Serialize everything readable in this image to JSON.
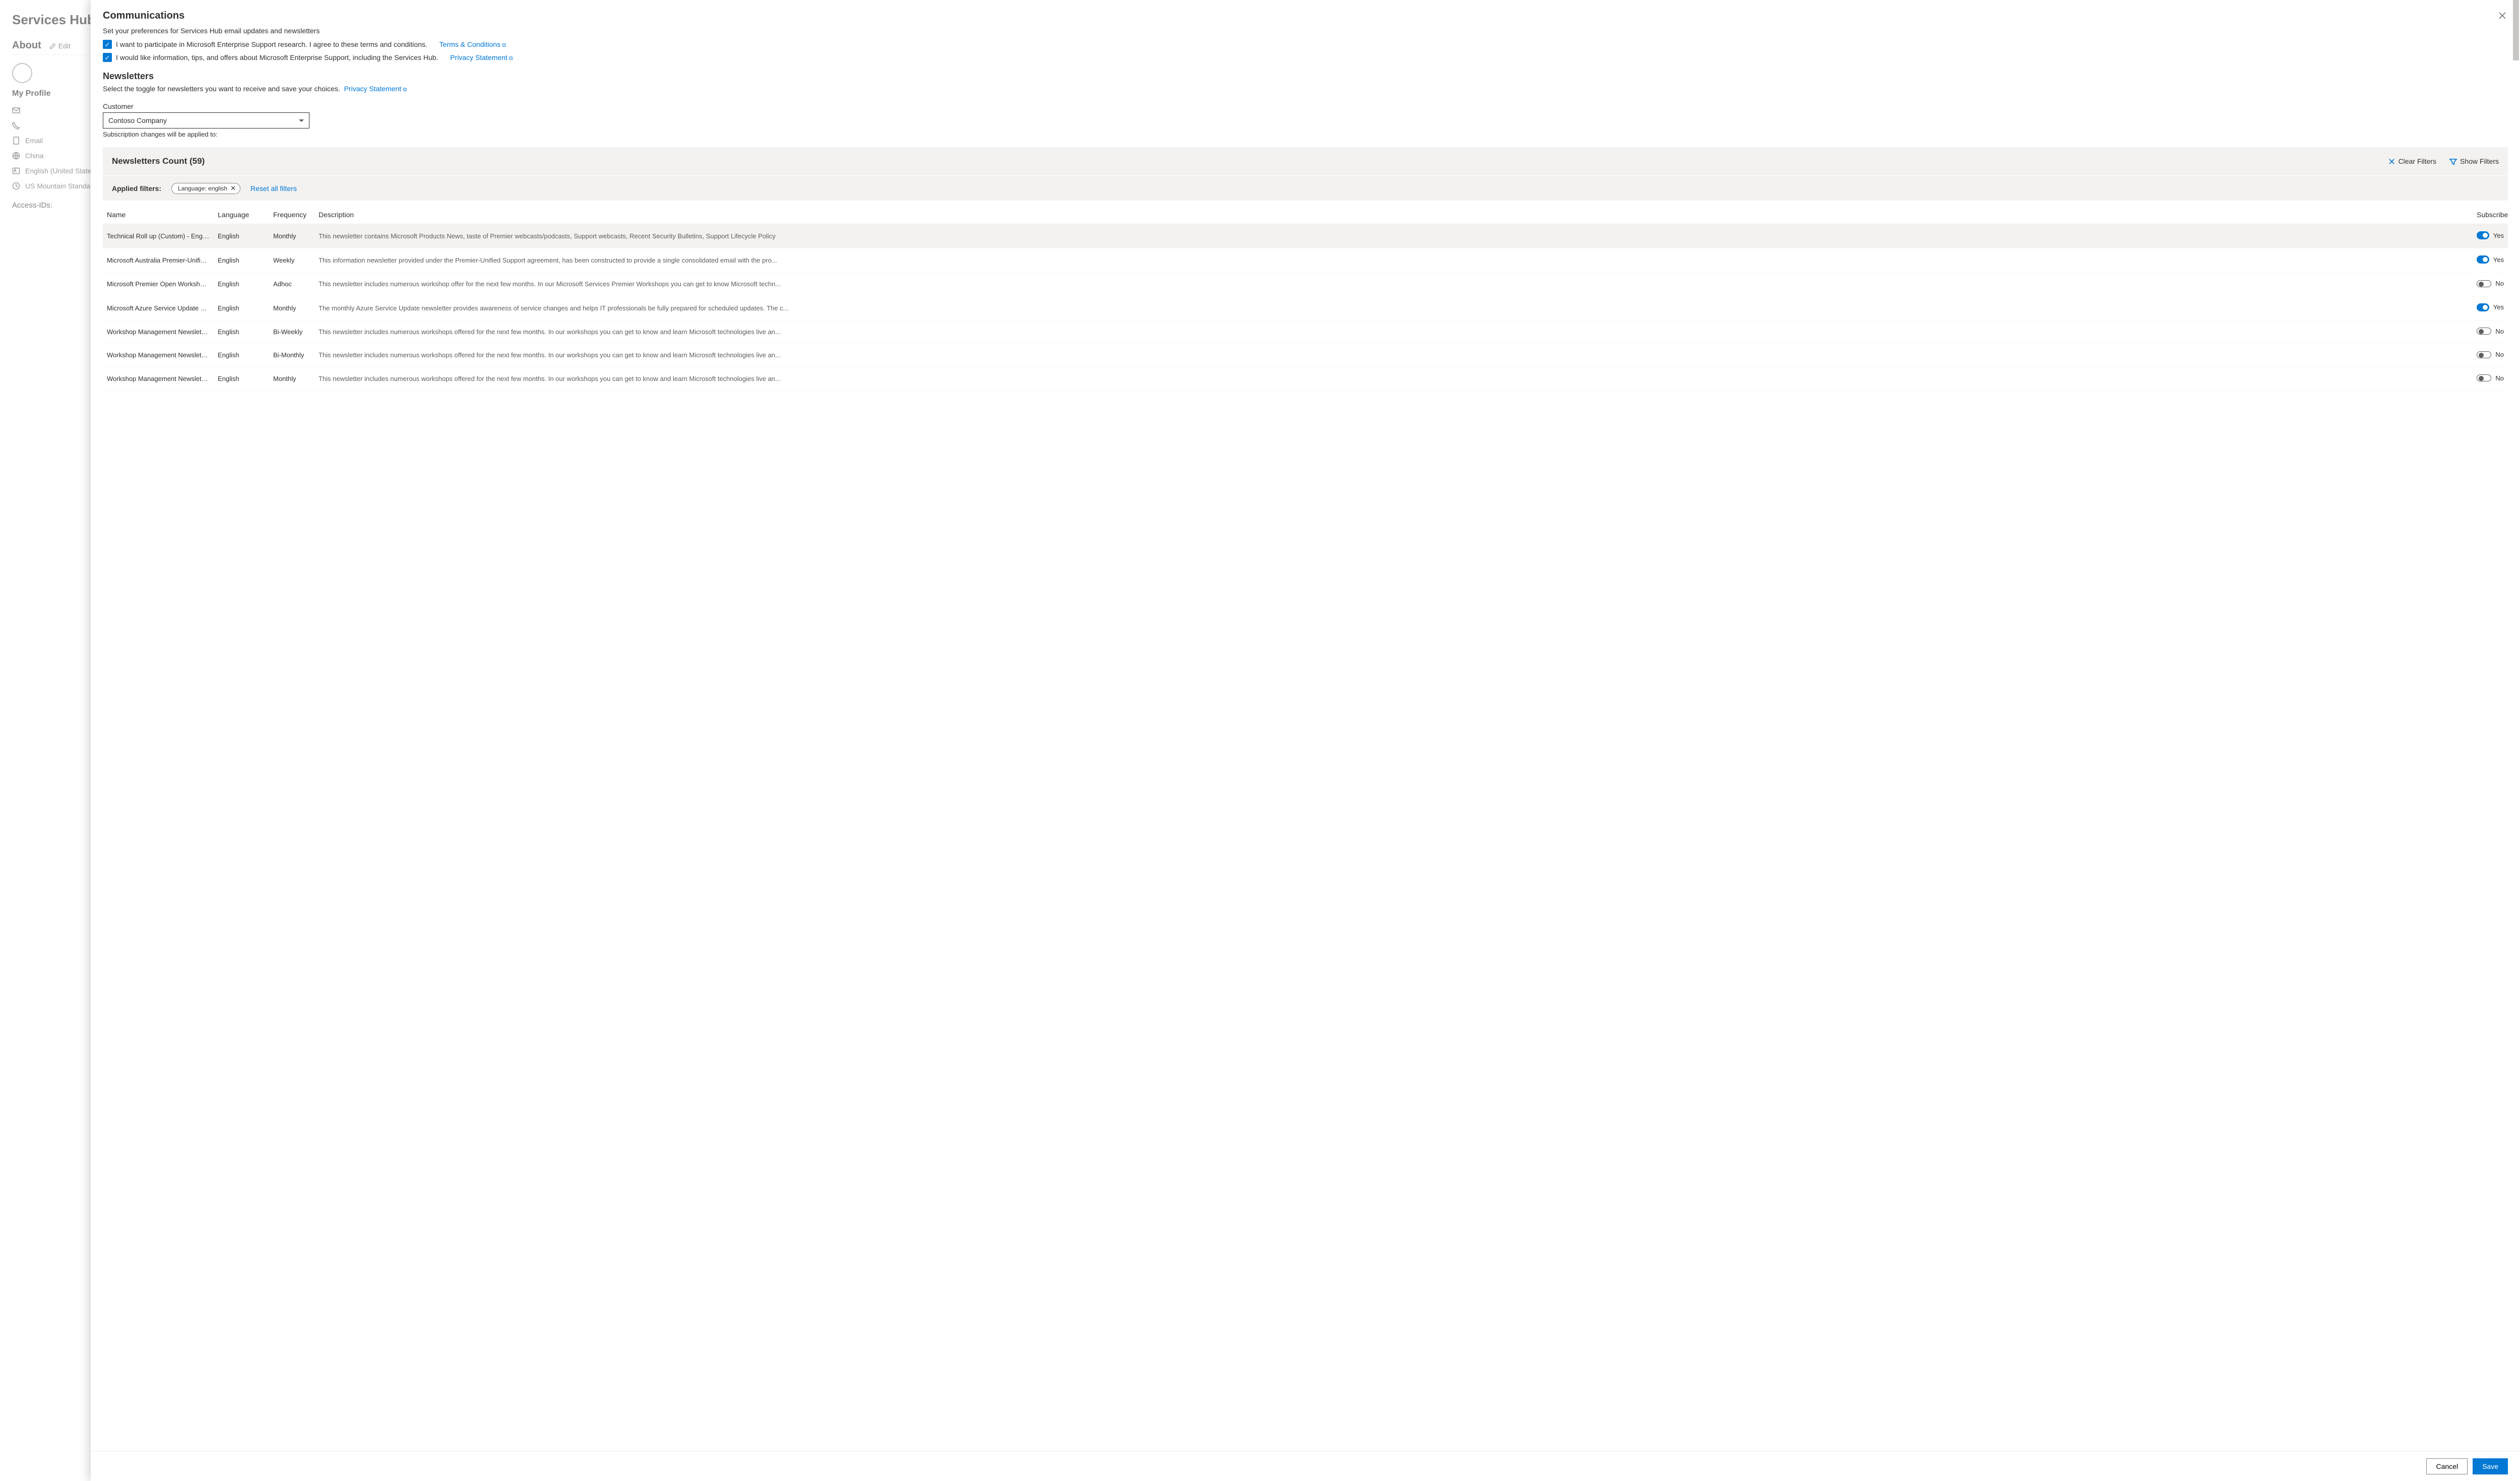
{
  "bg": {
    "pageTitle": "Services Hub P",
    "aboutTitle": "About",
    "editLabel": "Edit",
    "myProfile": "My Profile",
    "items": {
      "email": "Email",
      "country": "China",
      "lang": "English (United States)",
      "tz": "US Mountain Standard Tim"
    },
    "accessIds": "Access-IDs:"
  },
  "panel": {
    "communications": "Communications",
    "commSub": "Set your preferences for Services Hub email updates and newsletters",
    "check1": "I want to participate in Microsoft Enterprise Support research. I agree to these terms and conditions.",
    "terms": "Terms & Conditions",
    "check2": "I would like information, tips, and offers about Microsoft Enterprise Support, including the Services Hub.",
    "privacy": "Privacy Statement",
    "newsletters": "Newsletters",
    "newsSub": "Select the toggle for newsletters you want to receive and save your choices.",
    "customerLabel": "Customer",
    "customerValue": "Contoso Company",
    "applyHint": "Subscription changes will be applied to:",
    "countTitle": "Newsletters Count (59)",
    "clearFilters": "Clear Filters",
    "showFilters": "Show Filters",
    "appliedFilters": "Applied filters:",
    "chip": "Language: english",
    "resetFilters": "Reset all filters",
    "cols": {
      "name": "Name",
      "lang": "Language",
      "freq": "Frequency",
      "desc": "Description",
      "sub": "Subscribed"
    },
    "rows": [
      {
        "name": "Technical Roll up (Custom) - English",
        "lang": "English",
        "freq": "Monthly",
        "desc": "This newsletter contains Microsoft Products News, taste of Premier webcasts/podcasts, Support webcasts, Recent Security Bulletins, Support Lifecycle Policy",
        "sub": true,
        "subLabel": "Yes",
        "selected": true
      },
      {
        "name": "Microsoft Australia Premier-Unified Supp...",
        "lang": "English",
        "freq": "Weekly",
        "desc": "This information newsletter provided under the Premier-Unified Support agreement, has been constructed to provide a single consolidated email with the pro...",
        "sub": true,
        "subLabel": "Yes"
      },
      {
        "name": "Microsoft Premier Open Workshops for S...",
        "lang": "English",
        "freq": "Adhoc",
        "desc": "This newsletter includes numerous workshop offer for the next few months. In our Microsoft Services Premier Workshops you can get to know Microsoft techn...",
        "sub": false,
        "subLabel": "No"
      },
      {
        "name": "Microsoft Azure Service Update Manage...",
        "lang": "English",
        "freq": "Monthly",
        "desc": "The monthly Azure Service Update newsletter provides awareness of service changes and helps IT professionals be fully prepared for scheduled updates. The c...",
        "sub": true,
        "subLabel": "Yes"
      },
      {
        "name": "Workshop Management Newsletter - Can...",
        "lang": "English",
        "freq": "Bi-Weekly",
        "desc": "This newsletter includes numerous workshops offered for the next few months. In our workshops you can get to know and learn Microsoft technologies live an...",
        "sub": false,
        "subLabel": "No"
      },
      {
        "name": "Workshop Management Newsletter - Bel...",
        "lang": "English",
        "freq": "Bi-Monthly",
        "desc": "This newsletter includes numerous workshops offered for the next few months. In our workshops you can get to know and learn Microsoft technologies live an...",
        "sub": false,
        "subLabel": "No"
      },
      {
        "name": "Workshop Management Newsletter - Den...",
        "lang": "English",
        "freq": "Monthly",
        "desc": "This newsletter includes numerous workshops offered for the next few months. In our workshops you can get to know and learn Microsoft technologies live an...",
        "sub": false,
        "subLabel": "No"
      }
    ],
    "cancel": "Cancel",
    "save": "Save"
  }
}
